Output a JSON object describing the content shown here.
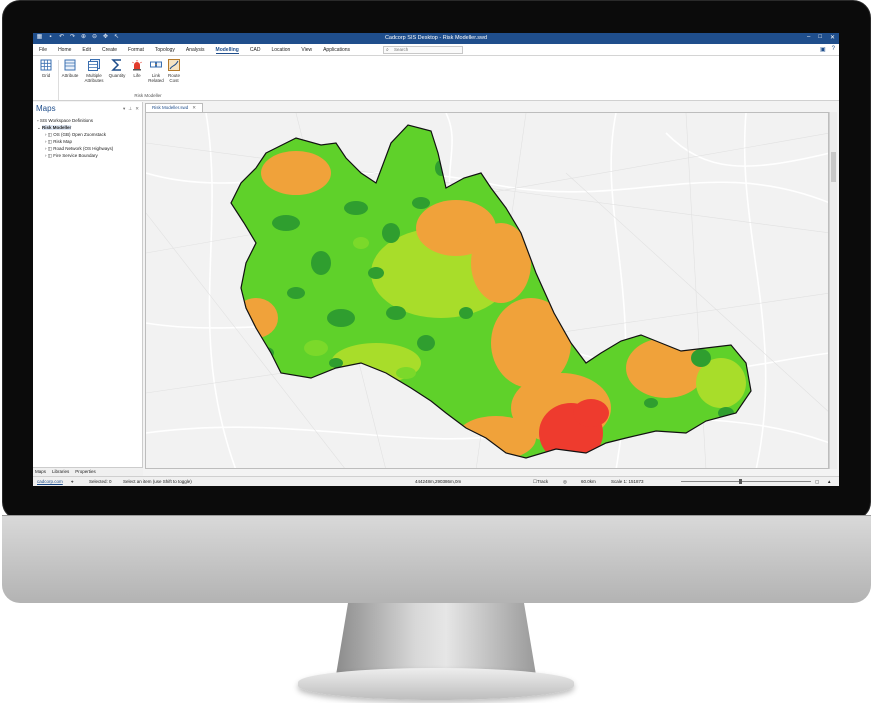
{
  "window": {
    "title": "Cadcorp SIS Desktop  -  Risk Modeller.swd"
  },
  "menu": {
    "tabs": [
      "File",
      "Home",
      "Edit",
      "Create",
      "Format",
      "Topology",
      "Analysis",
      "Modelling",
      "CAD",
      "Location",
      "View",
      "Applications"
    ],
    "active_tab": "Modelling",
    "search_placeholder": "Search"
  },
  "ribbon": {
    "buttons": [
      {
        "label": "Grid",
        "icon": "grid-icon"
      },
      {
        "label": "Attribute",
        "icon": "attribute-icon"
      },
      {
        "label": "Multiple Attributes",
        "icon": "multiple-attributes-icon"
      },
      {
        "label": "Quantity",
        "icon": "sigma-icon"
      },
      {
        "label": "Life",
        "icon": "siren-icon"
      },
      {
        "label": "Link Related",
        "icon": "link-related-icon"
      },
      {
        "label": "Route Cost",
        "icon": "route-cost-icon"
      }
    ],
    "group_label": "Risk Modeller"
  },
  "maps_pane": {
    "title": "Maps",
    "tree": [
      {
        "label": "SIS Workspace Definitions",
        "level": 0
      },
      {
        "label": "Risk Modeller",
        "level": 0
      },
      {
        "label": "OS (GB) Open Zoomstack",
        "level": 1
      },
      {
        "label": "Risk Map",
        "level": 1
      },
      {
        "label": "Road Network (OS Highways)",
        "level": 1
      },
      {
        "label": "Fire Service Boundary",
        "level": 1
      }
    ],
    "bottom_tabs": [
      "Maps",
      "Libraries",
      "Properties"
    ]
  },
  "document_tab": {
    "label": "Risk Modeller.swd"
  },
  "status": {
    "link": "cadcorp.com",
    "selected": "Selected: 0",
    "hint": "Select an item (use Shift to toggle)",
    "coords": "444248m,290386m,0m",
    "track": "Track",
    "distance": "60.0km",
    "scale": "Scale 1: 151873"
  },
  "colors": {
    "accent": "#1f4e8c",
    "risk_low_dark": "#2f9e2f",
    "risk_low": "#5fd12a",
    "risk_mid": "#a8dd2a",
    "risk_high": "#f0a23a",
    "risk_very_high": "#ee3b2e",
    "boundary": "#111111"
  }
}
